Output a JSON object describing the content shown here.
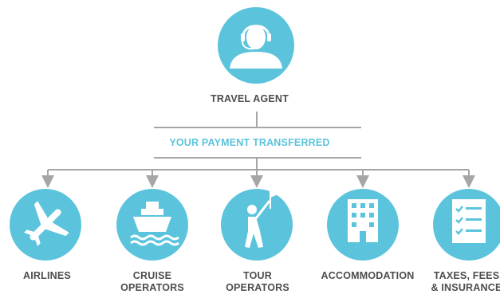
{
  "colors": {
    "accent": "#5bc4dc",
    "line": "#a6a6a6",
    "text": "#4d4d4d",
    "icon": "#ffffff"
  },
  "top_node": {
    "label": "TRAVEL AGENT",
    "icon": "headset-agent-icon"
  },
  "connector": {
    "label": "YOUR PAYMENT TRANSFERRED"
  },
  "nodes": [
    {
      "icon": "airplane-icon",
      "lines": [
        "AIRLINES"
      ]
    },
    {
      "icon": "cruise-ship-icon",
      "lines": [
        "CRUISE",
        "OPERATORS"
      ]
    },
    {
      "icon": "tour-guide-flag-icon",
      "lines": [
        "TOUR",
        "OPERATORS"
      ]
    },
    {
      "icon": "hotel-building-icon",
      "lines": [
        "ACCOMMODATION"
      ]
    },
    {
      "icon": "checklist-icon",
      "lines": [
        "TAXES, FEES",
        "& INSURANCE"
      ]
    }
  ]
}
